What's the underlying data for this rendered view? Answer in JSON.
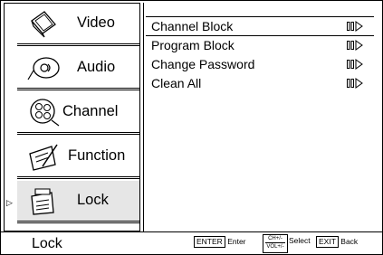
{
  "sidebar": {
    "items": [
      {
        "label": "Video",
        "icon": "tv-icon"
      },
      {
        "label": "Audio",
        "icon": "speaker-icon"
      },
      {
        "label": "Channel",
        "icon": "channel-dial-icon"
      },
      {
        "label": "Function",
        "icon": "function-icon"
      },
      {
        "label": "Lock",
        "icon": "lock-doc-icon",
        "selected": true
      }
    ],
    "pointer": "▷"
  },
  "panel": {
    "rows": [
      {
        "label": "Channel Block",
        "selected": true
      },
      {
        "label": "Program Block"
      },
      {
        "label": "Change Password"
      },
      {
        "label": "Clean All"
      }
    ]
  },
  "footer": {
    "title": "Lock",
    "enter_key": "ENTER",
    "enter_text": "Enter",
    "select_key_top": "CH+/-",
    "select_key_bottom": "VOL+/-",
    "select_text": "Select",
    "exit_key": "EXIT",
    "exit_text": "Back"
  }
}
